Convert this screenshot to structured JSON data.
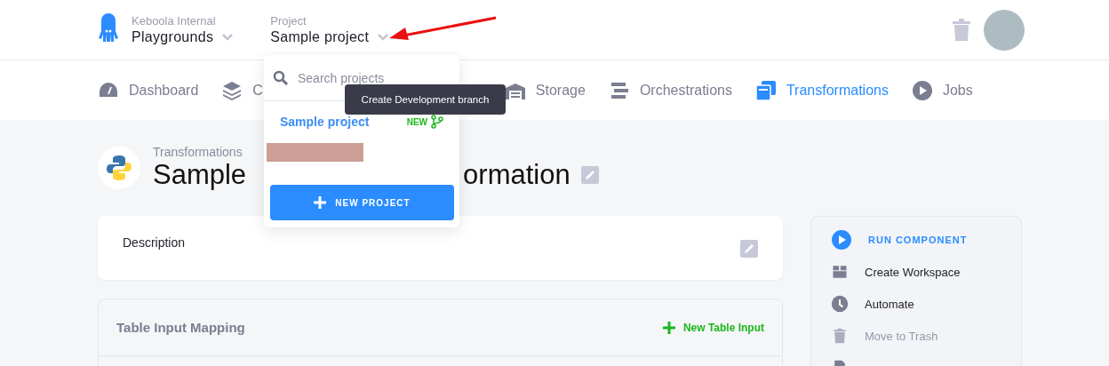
{
  "header": {
    "organization": {
      "label": "Keboola Internal",
      "value": "Playgrounds"
    },
    "project": {
      "label": "Project",
      "value": "Sample project"
    }
  },
  "nav": [
    {
      "label": "Dashboard",
      "selected": false
    },
    {
      "label": "C",
      "selected": false
    },
    {
      "label": "Storage",
      "selected": false
    },
    {
      "label": "Orchestrations",
      "selected": false
    },
    {
      "label": "Transformations",
      "selected": true
    },
    {
      "label": "Jobs",
      "selected": false
    }
  ],
  "project_dropdown": {
    "search": {
      "placeholder": "Search projects"
    },
    "projects": [
      {
        "name": "Sample project",
        "badge": "NEW",
        "selected": true
      }
    ],
    "new_project_button": "NEW PROJECT"
  },
  "tooltip": "Create Development branch",
  "page": {
    "breadcrumb": "Transformations",
    "title_parts": [
      "Sample",
      "ormation"
    ]
  },
  "description": {
    "title": "Description"
  },
  "input_mapping": {
    "title": "Table Input Mapping",
    "add_button": "New Table Input"
  },
  "actions": [
    {
      "kind": "primary",
      "label": "RUN COMPONENT",
      "disabled": false
    },
    {
      "kind": "item",
      "label": "Create Workspace",
      "disabled": false
    },
    {
      "kind": "item",
      "label": "Automate",
      "disabled": false
    },
    {
      "kind": "item",
      "label": "Move to Trash",
      "disabled": true
    },
    {
      "kind": "item",
      "disabled": false
    }
  ]
}
